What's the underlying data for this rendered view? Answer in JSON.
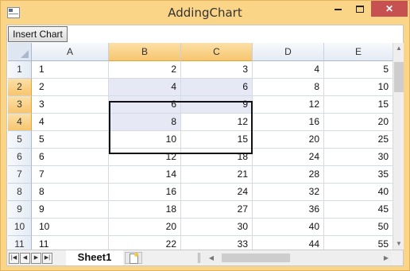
{
  "window": {
    "title": "AddingChart",
    "controls": {
      "minimize": "",
      "maximize": "",
      "close": "✕"
    }
  },
  "toolbar": {
    "insert_chart_label": "Insert Chart"
  },
  "grid": {
    "columns": [
      "A",
      "B",
      "C",
      "D",
      "E"
    ],
    "selected_columns": [
      "B",
      "C"
    ],
    "selected_rows": [
      "2",
      "3",
      "4"
    ],
    "rows": [
      {
        "num": "1",
        "cells": [
          "1",
          "2",
          "3",
          "4",
          "5"
        ]
      },
      {
        "num": "2",
        "cells": [
          "2",
          "4",
          "6",
          "8",
          "10"
        ]
      },
      {
        "num": "3",
        "cells": [
          "3",
          "6",
          "9",
          "12",
          "15"
        ]
      },
      {
        "num": "4",
        "cells": [
          "4",
          "8",
          "12",
          "16",
          "20"
        ]
      },
      {
        "num": "5",
        "cells": [
          "5",
          "10",
          "15",
          "20",
          "25"
        ]
      },
      {
        "num": "6",
        "cells": [
          "6",
          "12",
          "18",
          "24",
          "30"
        ]
      },
      {
        "num": "7",
        "cells": [
          "7",
          "14",
          "21",
          "28",
          "35"
        ]
      },
      {
        "num": "8",
        "cells": [
          "8",
          "16",
          "24",
          "32",
          "40"
        ]
      },
      {
        "num": "9",
        "cells": [
          "9",
          "18",
          "27",
          "36",
          "45"
        ]
      },
      {
        "num": "10",
        "cells": [
          "10",
          "20",
          "30",
          "40",
          "50"
        ]
      },
      {
        "num": "11",
        "cells": [
          "11",
          "22",
          "33",
          "44",
          "55"
        ]
      }
    ]
  },
  "sheets": {
    "active": "Sheet1"
  },
  "icons": {
    "nav_first": "first-sheet-icon",
    "nav_prev": "prev-sheet-icon",
    "nav_next": "next-sheet-icon",
    "nav_last": "last-sheet-icon",
    "new_sheet": "new-sheet-icon"
  },
  "colors": {
    "selected_header": "#f7c56d",
    "selection_fill": "#e6e8f6",
    "titlebar": "#fbd587",
    "close_button": "#c75050"
  }
}
